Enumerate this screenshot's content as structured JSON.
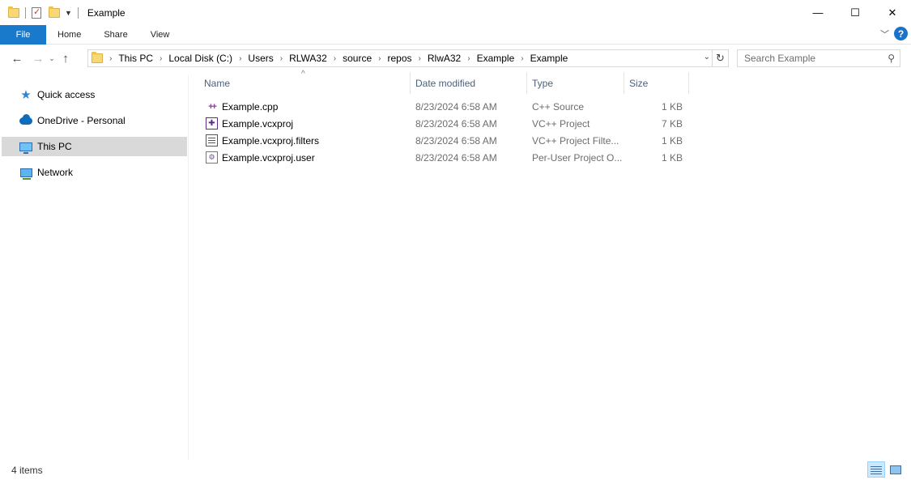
{
  "window": {
    "title": "Example",
    "minimize_glyph": "—",
    "maximize_glyph": "☐",
    "close_glyph": "✕"
  },
  "ribbon": {
    "tabs": [
      {
        "label": "File"
      },
      {
        "label": "Home"
      },
      {
        "label": "Share"
      },
      {
        "label": "View"
      }
    ]
  },
  "address": {
    "crumbs": [
      "This PC",
      "Local Disk (C:)",
      "Users",
      "RLWA32",
      "source",
      "repos",
      "RlwA32",
      "Example",
      "Example"
    ],
    "search_placeholder": "Search Example"
  },
  "nav": {
    "items": [
      {
        "label": "Quick access",
        "icon": "star-icon",
        "selected": false
      },
      {
        "label": "OneDrive - Personal",
        "icon": "cloud-icon",
        "selected": false
      },
      {
        "label": "This PC",
        "icon": "pc-icon",
        "selected": true
      },
      {
        "label": "Network",
        "icon": "network-icon",
        "selected": false
      }
    ]
  },
  "columns": {
    "name": "Name",
    "date": "Date modified",
    "type": "Type",
    "size": "Size"
  },
  "files": [
    {
      "name": "Example.cpp",
      "date": "8/23/2024 6:58 AM",
      "type": "C++ Source",
      "size": "1 KB",
      "icon": "cpp-file-icon"
    },
    {
      "name": "Example.vcxproj",
      "date": "8/23/2024 6:58 AM",
      "type": "VC++ Project",
      "size": "7 KB",
      "icon": "vcxproj-file-icon"
    },
    {
      "name": "Example.vcxproj.filters",
      "date": "8/23/2024 6:58 AM",
      "type": "VC++ Project Filte...",
      "size": "1 KB",
      "icon": "filters-file-icon"
    },
    {
      "name": "Example.vcxproj.user",
      "date": "8/23/2024 6:58 AM",
      "type": "Per-User Project O...",
      "size": "1 KB",
      "icon": "user-file-icon"
    }
  ],
  "status": {
    "item_count": "4 items"
  },
  "colors": {
    "file_tab": "#1979ca",
    "selected_nav": "#d9d9d9",
    "header_text": "#4c607a",
    "help": "#1a73c8"
  }
}
